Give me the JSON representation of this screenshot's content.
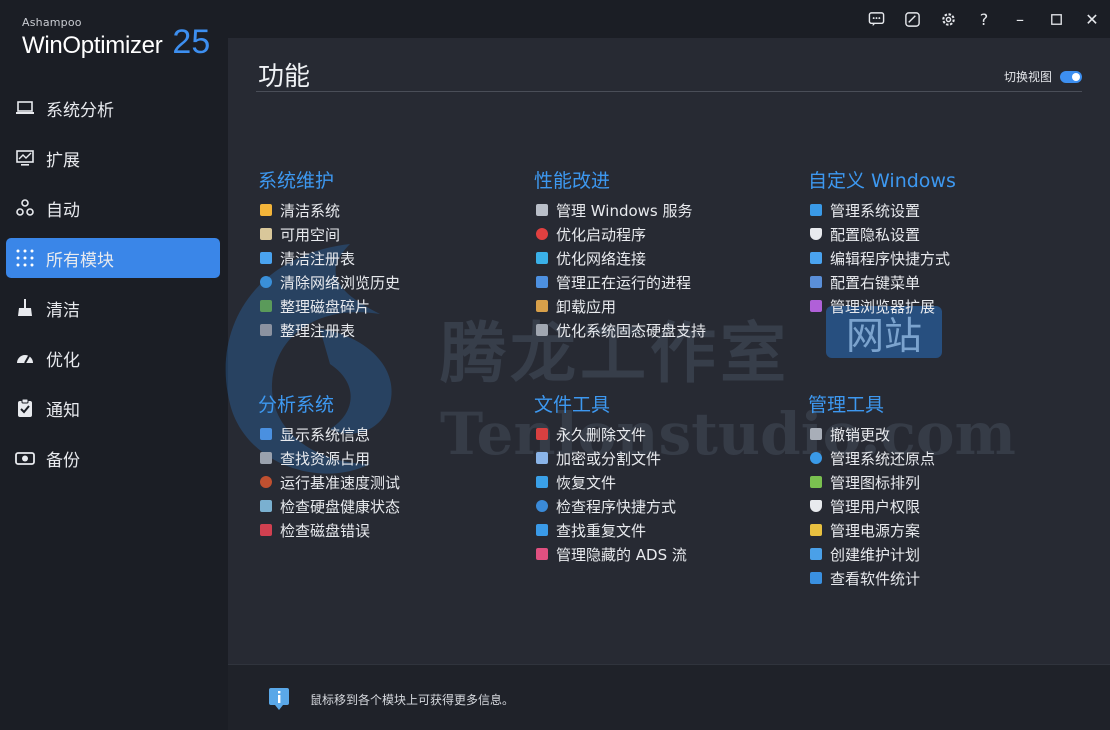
{
  "brand": {
    "vendor": "Ashampoo",
    "product": "WinOptimizer",
    "version": "25"
  },
  "titlebar": {
    "buttons": [
      {
        "name": "feedback-icon",
        "glyph": ""
      },
      {
        "name": "skin-icon",
        "glyph": ""
      },
      {
        "name": "settings-gear-icon",
        "glyph": ""
      },
      {
        "name": "help-icon",
        "glyph": "?"
      },
      {
        "name": "minimize-icon",
        "glyph": "–"
      },
      {
        "name": "maximize-icon",
        "glyph": ""
      },
      {
        "name": "close-icon",
        "glyph": "✕"
      }
    ]
  },
  "sidebar": {
    "items": [
      {
        "label": "系统分析",
        "icon": "laptop-icon"
      },
      {
        "label": "扩展",
        "icon": "monitor-chart-icon"
      },
      {
        "label": "自动",
        "icon": "automation-icon"
      },
      {
        "label": "所有模块",
        "icon": "grid-dots-icon",
        "active": true
      },
      {
        "label": "清洁",
        "icon": "broom-icon"
      },
      {
        "label": "优化",
        "icon": "gauge-icon"
      },
      {
        "label": "通知",
        "icon": "clipboard-check-icon"
      },
      {
        "label": "备份",
        "icon": "backup-drive-icon"
      }
    ]
  },
  "main": {
    "title": "功能",
    "view_toggle_label": "切换视图",
    "groups": [
      {
        "title": "系统维护",
        "modules": [
          "清洁系统",
          "可用空间",
          "清洁注册表",
          "清除网络浏览历史",
          "整理磁盘碎片",
          "整理注册表"
        ]
      },
      {
        "title": "性能改进",
        "modules": [
          "管理 Windows 服务",
          "优化启动程序",
          "优化网络连接",
          "管理正在运行的进程",
          "卸载应用",
          "优化系统固态硬盘支持"
        ]
      },
      {
        "title": "自定义 Windows",
        "modules": [
          "管理系统设置",
          "配置隐私设置",
          "编辑程序快捷方式",
          "配置右键菜单",
          "管理浏览器扩展"
        ]
      },
      {
        "title": "分析系统",
        "modules": [
          "显示系统信息",
          "查找资源占用",
          "运行基准速度测试",
          "检查硬盘健康状态",
          "检查磁盘错误"
        ]
      },
      {
        "title": "文件工具",
        "modules": [
          "永久删除文件",
          "加密或分割文件",
          "恢复文件",
          "检查程序快捷方式",
          "查找重复文件",
          "管理隐藏的 ADS 流"
        ]
      },
      {
        "title": "管理工具",
        "modules": [
          "撤销更改",
          "管理系统还原点",
          "管理图标排列",
          "管理用户权限",
          "管理电源方案",
          "创建维护计划",
          "查看软件统计"
        ]
      }
    ]
  },
  "watermark": {
    "cn": "腾龙工作室",
    "en": "Tenlonstudio.com",
    "badge": "网站"
  },
  "footer": {
    "hint": "鼠标移到各个模块上可获得更多信息。"
  },
  "colors": {
    "accent": "#3d8ff0",
    "active_nav": "#3a86e8",
    "group_title": "#3d98f0"
  }
}
